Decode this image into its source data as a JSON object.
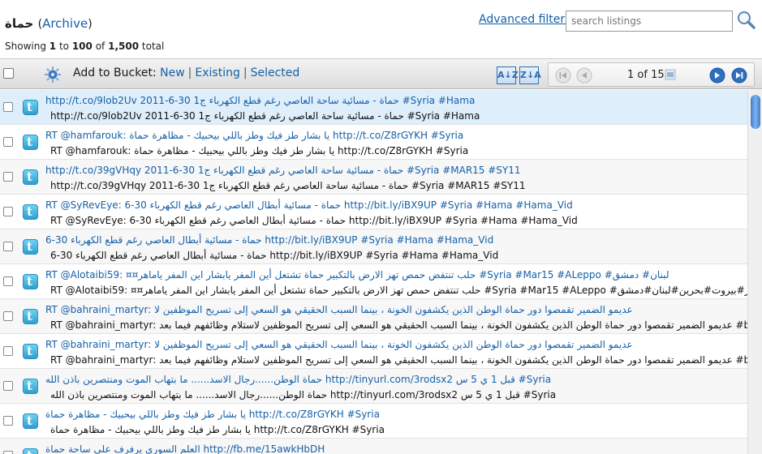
{
  "header": {
    "title": "حماة",
    "archive_open": "(",
    "archive_link": "Archive",
    "archive_close": ")",
    "showing_prefix": "Showing",
    "showing_from": "1",
    "showing_to_word": "to",
    "showing_to": "100",
    "showing_of_word": "of",
    "showing_total": "1,500",
    "showing_suffix": "total",
    "advanced_filters": "Advanced filters",
    "search_placeholder": "search listings"
  },
  "toolbar": {
    "add_to_bucket": "Add to Bucket:",
    "new": "New",
    "existing": "Existing",
    "selected": "Selected",
    "sort_az_label": "A↓Z",
    "sort_za_label": "Z↓A",
    "page_text": "1 of 15"
  },
  "rows": [
    {
      "l1": "http://t.co/9lob2Uv 2011-6-30 حماة - مسائية ساحة العاصي رغم قطع الكهرباء ج1 #Syria #Hama",
      "l2": "http://t.co/9lob2Uv 2011-6-30 حماة - مسائية ساحة العاصي رغم قطع الكهرباء ج1 #Syria #Hama"
    },
    {
      "l1": "RT @hamfarouk: يا بشار طز فيك وطز باللي بيحبيك - مظاهرة حماة http://t.co/Z8rGYKH #Syria",
      "l2": "RT @hamfarouk: يا بشار طز فيك وطز باللي بيحبيك - مظاهرة حماة http://t.co/Z8rGYKH #Syria"
    },
    {
      "l1": "http://t.co/39gVHqy 2011-6-30 حماة - مسائية ساحة العاصي رغم قطع الكهرباء ج1 #Syria #MAR15 #SY11",
      "l2": "http://t.co/39gVHqy 2011-6-30 حماة - مسائية ساحة العاصي رغم قطع الكهرباء ج1 #Syria #MAR15 #SY11"
    },
    {
      "l1": "RT @SyRevEye: 6-30 حماة - مسائية أبطال العاصي رغم قطع الكهرباء http://bit.ly/iBX9UP #Syria #Hama #Hama_Vid",
      "l2": "RT @SyRevEye: 6-30 حماة - مسائية أبطال العاصي رغم قطع الكهرباء http://bit.ly/iBX9UP #Syria #Hama #Hama_Vid"
    },
    {
      "l1": "6-30 حماة - مسائية أبطال العاصي رغم قطع الكهرباء http://bit.ly/iBX9UP #Syria #Hama #Hama_Vid",
      "l2": "6-30 حماة - مسائية أبطال العاصي رغم قطع الكهرباء http://bit.ly/iBX9UP #Syria #Hama #Hama_Vid"
    },
    {
      "l1": "RT @Alotaibi59: ¤¤حلب تنتفض حمص تهز الارض بالتكبير حماة تشتعل أين المفر يابشار اين المفر ياماهر #Syria #Mar15 #ALeppo #لبنان# دمشق",
      "l2": "RT @Alotaibi59: ¤¤حلب تنتفض حمص تهز الارض بالتكبير حماة تشتعل أين المفر يابشار اين المفر ياماهر #Syria #Mar15 #ALeppo #العراق#مصر#بيروت#بحرين#لبنان#دمشق"
    },
    {
      "l1": "RT @bahraini_martyr: عديمو الضمير تقمصوا دور حماة الوطن الذين يكشفون الخونة ، بينما السبب الحقيقي هو السعي إلى تسريح الموظفين لا",
      "l2": "RT @bahraini_martyr: عديمو الضمير تقمصوا دور حماة الوطن الذين يكشفون الخونة ، بينما السبب الحقيقي هو السعي إلى تسريح الموظفين لاستلام وظائفهم فيما بعد #bahrain"
    },
    {
      "l1": "RT @bahraini_martyr: عديمو الضمير تقمصوا دور حماة الوطن الذين يكشفون الخونة ، بينما السبب الحقيقي هو السعي إلى تسريح الموظفين لا",
      "l2": "RT @bahraini_martyr: عديمو الضمير تقمصوا دور حماة الوطن الذين يكشفون الخونة ، بينما السبب الحقيقي هو السعي إلى تسريح الموظفين لاستلام وظائفهم فيما بعد #bahrain"
    },
    {
      "l1": "حماة الوطن......رجال الاسد...... ما بتهاب الموت ومنتصرين باذن الله http://tinyurl.com/3rodsx2 قبل 1 ي 5 س #Syria",
      "l2": "حماة الوطن......رجال الاسد...... ما بتهاب الموت ومنتصرين باذن الله http://tinyurl.com/3rodsx2 قبل 1 ي 5 س #Syria"
    },
    {
      "l1": "يا بشار طز فيك وطز باللي بيحبيك - مظاهرة حماة http://t.co/Z8rGYKH #Syria",
      "l2": "يا بشار طز فيك وطز باللي بيحبيك - مظاهرة حماة http://t.co/Z8rGYKH #Syria"
    },
    {
      "l1": "العلم السوري يرفرف على ساحة حماة http://fb.me/15awkHbDH",
      "l2": ""
    }
  ]
}
